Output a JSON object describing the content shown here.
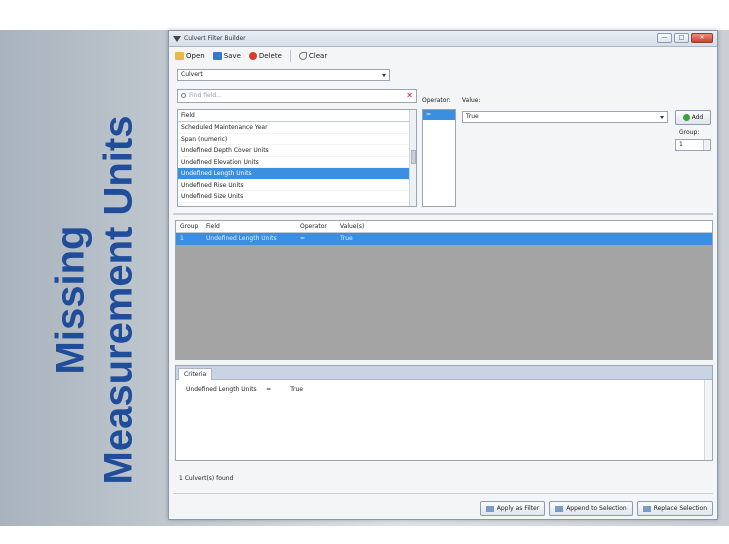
{
  "slide": {
    "title_line1": "Missing",
    "title_line2": "Measurement Units"
  },
  "window": {
    "title": "Culvert Filter Builder",
    "controls": [
      "—",
      "□",
      "✕"
    ]
  },
  "toolbar": {
    "open_label": "Open",
    "save_label": "Save",
    "delete_label": "Delete",
    "clear_label": "Clear"
  },
  "layer_select": {
    "value": "Culvert"
  },
  "find": {
    "placeholder": "Find field..."
  },
  "field_list": {
    "header": "Field",
    "items": [
      "Scheduled Maintenance Year",
      "Span (numeric)",
      "Undefined Depth Cover Units",
      "Undefined Elevation Units",
      "Undefined Length Units",
      "Undefined Rise Units",
      "Undefined Size Units"
    ],
    "selected_index": 4
  },
  "operator": {
    "label": "Operator:",
    "items": [
      "="
    ],
    "selected": "="
  },
  "value": {
    "label": "Value:",
    "selected": "True"
  },
  "add_button": {
    "label": "Add"
  },
  "group": {
    "label": "Group:",
    "value": "1"
  },
  "grid": {
    "columns": [
      "Group",
      "Field",
      "Operator",
      "Value(s)"
    ],
    "rows": [
      {
        "group": "1",
        "field": "Undefined Length Units",
        "operator": "=",
        "value": "True"
      }
    ]
  },
  "criteria": {
    "tab": "Criteria",
    "text": "Undefined Length Units     =          True"
  },
  "status": {
    "text": "1 Culvert(s) found"
  },
  "buttons": {
    "apply": "Apply as Filter",
    "append": "Append to Selection",
    "replace": "Replace Selection"
  }
}
